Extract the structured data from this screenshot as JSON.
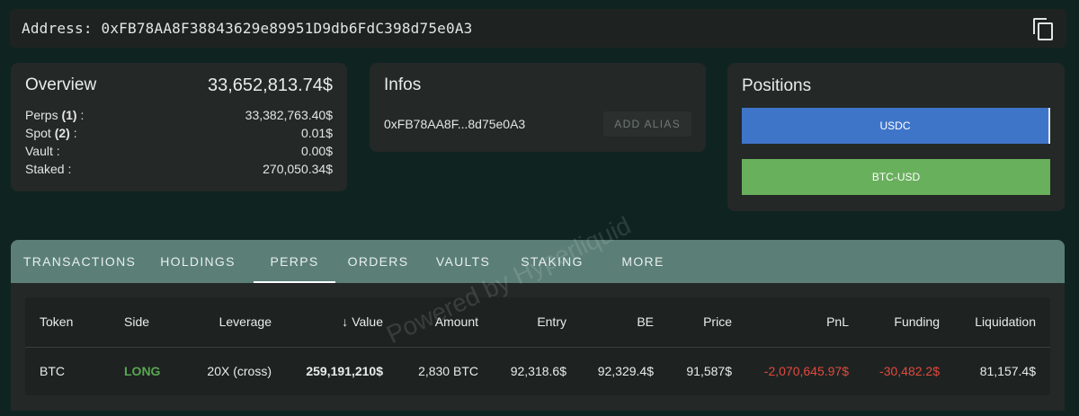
{
  "address_bar": {
    "label": "Address:",
    "value": "0xFB78AA8F38843629e89951D9db6FdC398d75e0A3"
  },
  "overview": {
    "title": "Overview",
    "total": "33,652,813.74$",
    "rows": [
      {
        "label": "Perps",
        "count": "(1)",
        "suffix": " :",
        "value": "33,382,763.40$"
      },
      {
        "label": "Spot",
        "count": "(2)",
        "suffix": " :",
        "value": "0.01$"
      },
      {
        "label": "Vault :",
        "count": "",
        "suffix": "",
        "value": "0.00$"
      },
      {
        "label": "Staked :",
        "count": "",
        "suffix": "",
        "value": "270,050.34$"
      }
    ]
  },
  "infos": {
    "title": "Infos",
    "short_address": "0xFB78AA8F...8d75e0A3",
    "alias_button": "ADD ALIAS"
  },
  "positions": {
    "title": "Positions",
    "items": [
      {
        "label": "USDC",
        "color": "#3f75c9"
      },
      {
        "label": "BTC-USD",
        "color": "#68b05c"
      }
    ]
  },
  "tabs": [
    "TRANSACTIONS",
    "HOLDINGS",
    "PERPS",
    "ORDERS",
    "VAULTS",
    "STAKING",
    "MORE"
  ],
  "active_tab": "PERPS",
  "table": {
    "columns": [
      "Token",
      "Side",
      "Leverage",
      "Value",
      "Amount",
      "Entry",
      "BE",
      "Price",
      "PnL",
      "Funding",
      "Liquidation"
    ],
    "sort_arrow": "↓",
    "rows": [
      [
        "BTC",
        "LONG",
        "20X (cross)",
        "259,191,210$",
        "2,830 BTC",
        "92,318.6$",
        "92,329.4$",
        "91,587$",
        "-2,070,645.97$",
        "-30,482.2$",
        "81,157.4$"
      ]
    ]
  },
  "watermark": "Powered by Hyperliquid",
  "colors": {
    "long": "#5aa552",
    "negative": "#e2483c",
    "tabbar": "#5b7f77"
  }
}
